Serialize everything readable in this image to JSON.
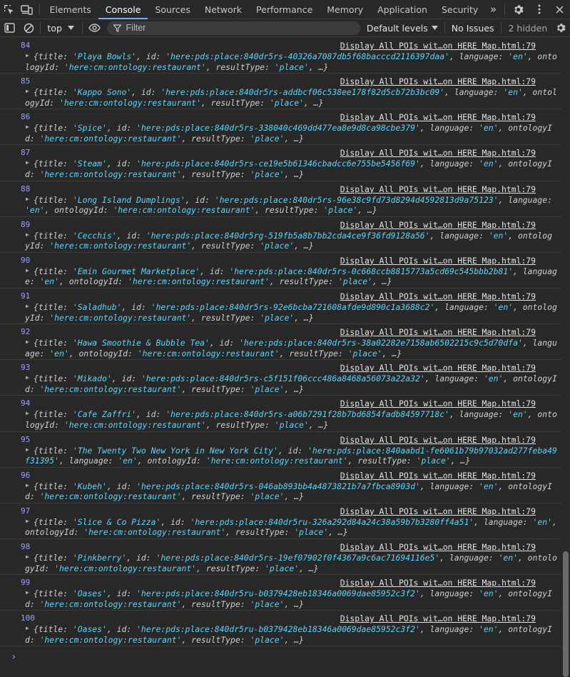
{
  "tabs": [
    {
      "label": "Elements",
      "active": false
    },
    {
      "label": "Console",
      "active": true
    },
    {
      "label": "Sources",
      "active": false
    },
    {
      "label": "Network",
      "active": false
    },
    {
      "label": "Performance",
      "active": false
    },
    {
      "label": "Memory",
      "active": false
    },
    {
      "label": "Application",
      "active": false
    },
    {
      "label": "Security",
      "active": false
    }
  ],
  "more_tabs": "»",
  "toolbar": {
    "context": "top",
    "filter_placeholder": "Filter",
    "levels": "Default levels",
    "issues": "No Issues",
    "hidden": "2 hidden"
  },
  "source_label": "Display All POIs wit…on HERE Map.html:79",
  "messages": [
    {
      "index": "84",
      "line1": [
        "{title: ",
        "'Playa Bowls'",
        ", id: ",
        "'here:pds:place:840dr5rs-40326a7087db5f68bacccd2116397daa'",
        ", language: ",
        "'en'",
        ", onto"
      ],
      "line2": [
        "logyId: ",
        "'here:cm:ontology:restaurant'",
        ", resultType: ",
        "'place'",
        ", …}"
      ]
    },
    {
      "index": "85",
      "line1": [
        "{title: ",
        "'Kappo Sono'",
        ", id: ",
        "'here:pds:place:840dr5rs-addbcf06c538ee178f82d5cb72b3bc09'",
        ", language: ",
        "'en'",
        ", ontol"
      ],
      "line2": [
        "ogyId: ",
        "'here:cm:ontology:restaurant'",
        ", resultType: ",
        "'place'",
        ", …}"
      ]
    },
    {
      "index": "86",
      "line1": [
        "{title: ",
        "'Spice'",
        ", id: ",
        "'here:pds:place:840dr5rs-338040c469dd477ea8e9d8ca98cbe379'",
        ", language: ",
        "'en'",
        ", ontologyI"
      ],
      "line2": [
        "d: ",
        "'here:cm:ontology:restaurant'",
        ", resultType: ",
        "'place'",
        ", …}"
      ]
    },
    {
      "index": "87",
      "line1": [
        "{title: ",
        "'Steam'",
        ", id: ",
        "'here:pds:place:840dr5rs-ce19e5b61346cbadcc6e755be5456f69'",
        ", language: ",
        "'en'",
        ", ontologyI"
      ],
      "line2": [
        "d: ",
        "'here:cm:ontology:restaurant'",
        ", resultType: ",
        "'place'",
        ", …}"
      ]
    },
    {
      "index": "88",
      "line1": [
        "{title: ",
        "'Long Island Dumplings'",
        ", id: ",
        "'here:pds:place:840dr5rs-96e38c9fd73d8294d4592813d9a75123'",
        ", language:",
        "",
        ""
      ],
      "line2": [
        "",
        "'en'",
        ", ontologyId: ",
        "'here:cm:ontology:restaurant'",
        ", resultType: ",
        "'place'",
        ", …}"
      ]
    },
    {
      "index": "89",
      "line1": [
        "{title: ",
        "'Cecchis'",
        ", id: ",
        "'here:pds:place:840dr5rg-519fb5a8b7bb2cda4ce9f36fd9128a56'",
        ", language: ",
        "'en'",
        ", ontolog"
      ],
      "line2": [
        "yId: ",
        "'here:cm:ontology:restaurant'",
        ", resultType: ",
        "'place'",
        ", …}"
      ]
    },
    {
      "index": "90",
      "line1": [
        "{title: ",
        "'Emin Gourmet Marketplace'",
        ", id: ",
        "'here:pds:place:840dr5rs-0c668ccb8815773a5cd69c545bbb2b81'",
        ", languag",
        "",
        ""
      ],
      "line2": [
        "e: ",
        "'en'",
        ", ontologyId: ",
        "'here:cm:ontology:restaurant'",
        ", resultType: ",
        "'place'",
        ", …}"
      ]
    },
    {
      "index": "91",
      "line1": [
        "{title: ",
        "'Saladhub'",
        ", id: ",
        "'here:pds:place:840dr5rs-92e6bcba721608afde9d890c1a3688c2'",
        ", language: ",
        "'en'",
        ", ontolog"
      ],
      "line2": [
        "yId: ",
        "'here:cm:ontology:restaurant'",
        ", resultType: ",
        "'place'",
        ", …}"
      ]
    },
    {
      "index": "92",
      "line1": [
        "{title: ",
        "'Hawa Smoothie & Bubble Tea'",
        ", id: ",
        "'here:pds:place:840dr5rs-38a02282e7158ab6502215c9c5d70dfa'",
        ", langu",
        "",
        ""
      ],
      "line2": [
        "age: ",
        "'en'",
        ", ontologyId: ",
        "'here:cm:ontology:restaurant'",
        ", resultType: ",
        "'place'",
        ", …}"
      ]
    },
    {
      "index": "93",
      "line1": [
        "{title: ",
        "'Mikado'",
        ", id: ",
        "'here:pds:place:840dr5rs-c5f151f06ccc486a8468a56073a22a32'",
        ", language: ",
        "'en'",
        ", ontologyI"
      ],
      "line2": [
        "d: ",
        "'here:cm:ontology:restaurant'",
        ", resultType: ",
        "'place'",
        ", …}"
      ]
    },
    {
      "index": "94",
      "line1": [
        "{title: ",
        "'Cafe Zaffri'",
        ", id: ",
        "'here:pds:place:840dr5rs-a06b7291f28b7bd6854fadb84597718c'",
        ", language: ",
        "'en'",
        ", onto"
      ],
      "line2": [
        "logyId: ",
        "'here:cm:ontology:restaurant'",
        ", resultType: ",
        "'place'",
        ", …}"
      ]
    },
    {
      "index": "95",
      "line1": [
        "{title: ",
        "'The Twenty Two New York in New York City'",
        ", id: ",
        "'here:pds:place:840aabd1-fe6061b79b97032ad277feba49",
        "",
        "",
        ""
      ],
      "line2": [
        "f31395'",
        ", language: ",
        "'en'",
        ", ontologyId: ",
        "'here:cm:ontology:restaurant'",
        ", resultType: ",
        "'place'",
        ", …}"
      ]
    },
    {
      "index": "96",
      "line1": [
        "{title: ",
        "'Kubeh'",
        ", id: ",
        "'here:pds:place:840dr5rs-046ab893bb4a4873821b7a7fbca8903d'",
        ", language: ",
        "'en'",
        ", ontologyI"
      ],
      "line2": [
        "d: ",
        "'here:cm:ontology:restaurant'",
        ", resultType: ",
        "'place'",
        ", …}"
      ]
    },
    {
      "index": "97",
      "line1": [
        "{title: ",
        "'Slice & Co Pizza'",
        ", id: ",
        "'here:pds:place:840dr5ru-326a292d84a24c38a59b7b3280ff4a51'",
        ", language: ",
        "'en'",
        ","
      ],
      "line2": [
        "ontologyId: ",
        "'here:cm:ontology:restaurant'",
        ", resultType: ",
        "'place'",
        ", …}"
      ]
    },
    {
      "index": "98",
      "line1": [
        "{title: ",
        "'Pinkberry'",
        ", id: ",
        "'here:pds:place:840dr5rs-19ef07902f0f4367a9c6ac71694116e5'",
        ", language: ",
        "'en'",
        ", ontolo"
      ],
      "line2": [
        "gyId: ",
        "'here:cm:ontology:restaurant'",
        ", resultType: ",
        "'place'",
        ", …}"
      ]
    },
    {
      "index": "99",
      "line1": [
        "{title: ",
        "'Oases'",
        ", id: ",
        "'here:pds:place:840dr5ru-b0379428eb18346a0069dae85952c3f2'",
        ", language: ",
        "'en'",
        ", ontologyI"
      ],
      "line2": [
        "d: ",
        "'here:cm:ontology:restaurant'",
        ", resultType: ",
        "'place'",
        ", …}"
      ]
    },
    {
      "index": "100",
      "line1": [
        "{title: ",
        "'Oases'",
        ", id: ",
        "'here:pds:place:840dr5ru-b0379428eb18346a0069dae85952c3f2'",
        ", language: ",
        "'en'",
        ", ontologyI"
      ],
      "line2": [
        "d: ",
        "'here:cm:ontology:restaurant'",
        ", resultType: ",
        "'place'",
        ", …}"
      ]
    }
  ],
  "prompt": "›",
  "icons": {
    "inspect": "inspect-element-icon",
    "device": "device-toolbar-icon",
    "settings": "gear-icon",
    "menu": "kebab-menu-icon",
    "close": "close-icon",
    "sidebar": "sidebar-toggle-icon",
    "clear": "clear-console-icon",
    "eye": "eye-icon",
    "filter": "filter-icon"
  },
  "colors": {
    "background": "#282828",
    "string": "#5cd5fb",
    "index": "#9aa0ff",
    "accent": "#7cacf8"
  }
}
